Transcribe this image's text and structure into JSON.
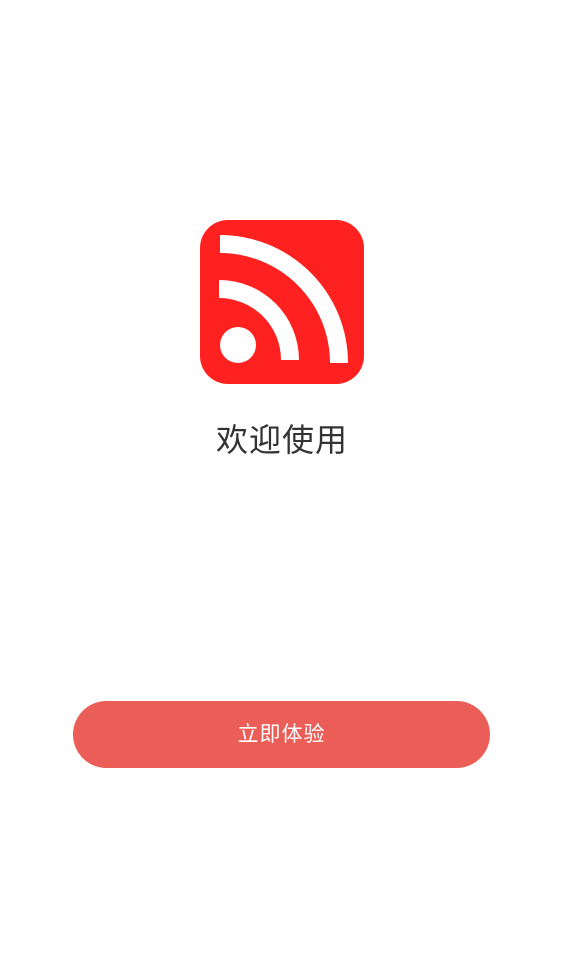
{
  "welcome": {
    "title": "欢迎使用"
  },
  "start_button": {
    "label": "立即体验"
  },
  "logo": {
    "icon": "rss-icon",
    "color": "#ff2020"
  },
  "colors": {
    "button_background": "#eb5e58",
    "text": "#333333",
    "background": "#ffffff"
  }
}
